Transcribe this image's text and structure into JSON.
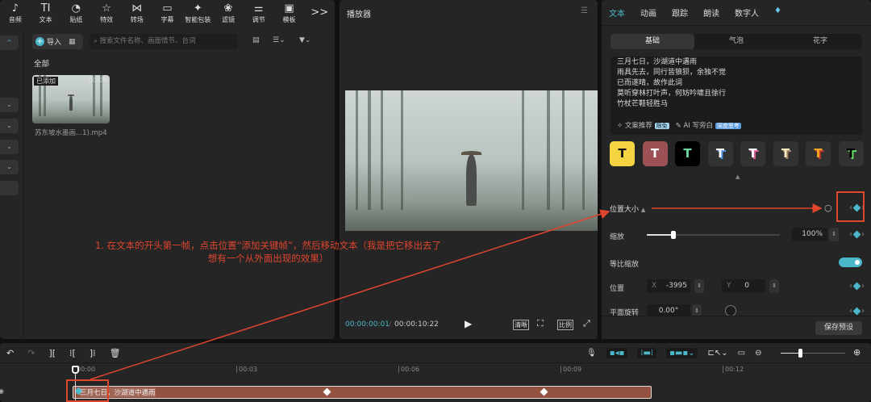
{
  "toolbar": {
    "items": [
      {
        "icon": "music-icon",
        "label": "音频"
      },
      {
        "icon": "text-icon",
        "label": "文本"
      },
      {
        "icon": "sticker-icon",
        "label": "贴纸"
      },
      {
        "icon": "effects-icon",
        "label": "特效"
      },
      {
        "icon": "transition-icon",
        "label": "转场"
      },
      {
        "icon": "subtitle-icon",
        "label": "字幕"
      },
      {
        "icon": "smart-pack-icon",
        "label": "智能包装"
      },
      {
        "icon": "filter-icon",
        "label": "滤镜"
      },
      {
        "icon": "adjust-icon",
        "label": "调节"
      },
      {
        "icon": "template-icon",
        "label": "模板"
      }
    ],
    "more": ">>"
  },
  "media": {
    "import_label": "导入",
    "search_placeholder": "搜索文件名称、画面情节、台词",
    "all_label": "全部",
    "clip": {
      "badge": "已添加",
      "duration": "00:06",
      "name": "苏东坡水墨画...1).mp4"
    }
  },
  "player": {
    "title": "播放器",
    "current_time": "00:00:00:01",
    "total_time": "00:00:10:22",
    "quality": "清晰",
    "ratio": "比例"
  },
  "annotation": {
    "line1": "1. 在文本的开头第一帧，点击位置“添加关键帧”，然后移动文本（我是把它移出去了",
    "line2": "想有一个从外面出现的效果）"
  },
  "inspector": {
    "tabs": [
      "文本",
      "动画",
      "跟踪",
      "朗读",
      "数字人"
    ],
    "segments": [
      "基础",
      "气泡",
      "花字"
    ],
    "text_lines": [
      "三月七日，沙湖道中遇雨",
      "雨具先去，同行皆狼狈，余独不觉",
      "已而遂晴，故作此词",
      "莫听穿林打叶声，何妨吟啸且徐行",
      "竹杖芒鞋轻胜马"
    ],
    "copy_recommend": "文案推荐",
    "copy_badge": "限免",
    "ai_narration": "AI 写旁白",
    "ai_badge": "深度思考",
    "presets": [
      {
        "bg": "#f5d442",
        "fg": "#111"
      },
      {
        "bg": "#9c5254",
        "fg": "#fff"
      },
      {
        "bg": "#000",
        "fg": "#6fd9a0"
      },
      {
        "bg": "#323232",
        "fg": "#fff",
        "shadow": "#4a8fe0"
      },
      {
        "bg": "#323232",
        "fg": "#fff",
        "shadow": "#e05a9a"
      },
      {
        "bg": "#323232",
        "fg": "#f7ecc4",
        "shadow": "#a08060"
      },
      {
        "bg": "#323232",
        "fg": "#f5a623",
        "shadow": "#c0392b"
      },
      {
        "bg": "#323232",
        "fg": "#000",
        "shadow": "#5fe05f"
      }
    ],
    "section": "位置大小",
    "scale_label": "缩放",
    "scale_value": "100%",
    "scale_level": 0.2,
    "uniform_label": "等比缩放",
    "uniform_on": true,
    "position_label": "位置",
    "x_label": "X",
    "x_value": "-3995",
    "y_label": "Y",
    "y_value": "0",
    "rotate_label": "平面旋转",
    "rotate_value": "0.00°",
    "save_preset": "保存预设"
  },
  "timeline": {
    "ticks": [
      "00:00",
      "00:03",
      "00:06",
      "00:09",
      "00:12"
    ],
    "clip_text": "三月七日，沙湖道中遇雨",
    "zoom_level": 0.3
  },
  "colors": {
    "accent": "#4bb8c9",
    "annotation": "#e0452e",
    "clip": "#93513f"
  }
}
